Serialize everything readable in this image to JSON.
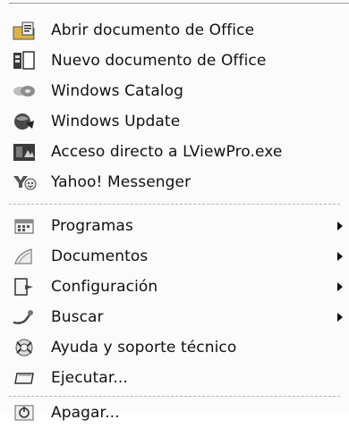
{
  "pinned": [
    {
      "label": "Abrir documento de Office",
      "icon": "open-office-document-icon"
    },
    {
      "label": "Nuevo documento de Office",
      "icon": "new-office-document-icon"
    },
    {
      "label": "Windows Catalog",
      "icon": "windows-catalog-icon"
    },
    {
      "label": "Windows Update",
      "icon": "windows-update-icon"
    },
    {
      "label": "Acceso directo a LViewPro.exe",
      "icon": "lviewpro-icon"
    },
    {
      "label": "Yahoo! Messenger",
      "icon": "yahoo-messenger-icon"
    }
  ],
  "system": [
    {
      "label": "Programas",
      "icon": "programs-icon",
      "submenu": true
    },
    {
      "label": "Documentos",
      "icon": "documents-icon",
      "submenu": true
    },
    {
      "label": "Configuración",
      "icon": "settings-icon",
      "submenu": true
    },
    {
      "label": "Buscar",
      "icon": "search-icon",
      "submenu": true
    },
    {
      "label": "Ayuda y soporte técnico",
      "icon": "help-icon",
      "submenu": false
    },
    {
      "label": "Ejecutar...",
      "icon": "run-icon",
      "submenu": false
    }
  ],
  "shutdown": {
    "label": "Apagar...",
    "icon": "shutdown-icon"
  }
}
